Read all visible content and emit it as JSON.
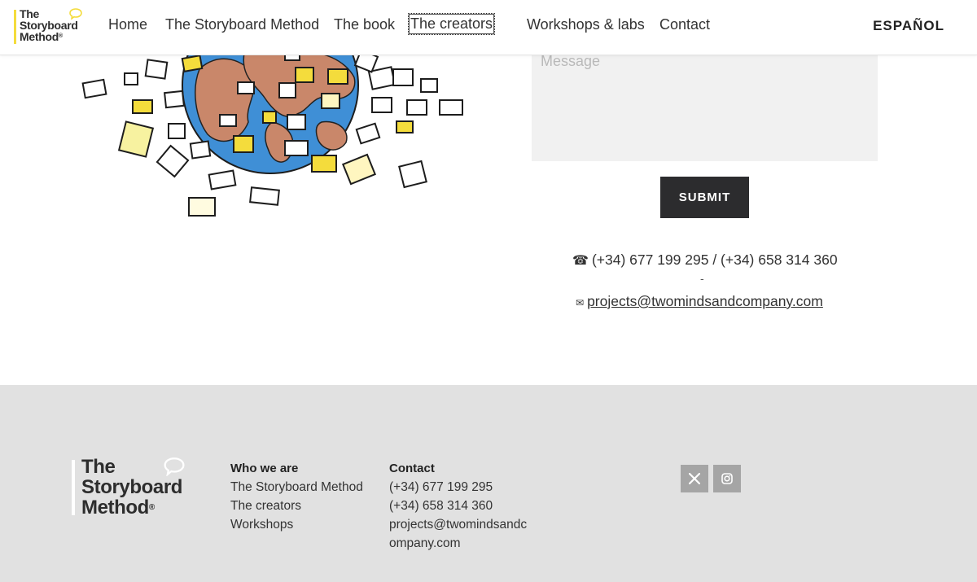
{
  "header": {
    "logo": {
      "line1": "The",
      "line2": "Storyboard",
      "line3": "Method",
      "mark": "®"
    },
    "nav": [
      {
        "label": "Home"
      },
      {
        "label": "The Storyboard Method"
      },
      {
        "label": "The book"
      },
      {
        "label": "The creators"
      },
      {
        "label": "Workshops & labs"
      },
      {
        "label": "Contact"
      }
    ],
    "language": "ESPAÑOL"
  },
  "form": {
    "message_placeholder": "Message",
    "submit_label": "SUBMIT"
  },
  "contact_info": {
    "phone_icon": "☎",
    "phones": "(+34) 677 199 295 / (+34) 658 314 360",
    "separator": "-",
    "email_icon": "✉",
    "email": "projects@twomindsandcompany.com"
  },
  "footer": {
    "logo": {
      "line1": "The",
      "line2": "Storyboard",
      "line3": "Method",
      "mark": "®"
    },
    "who": {
      "heading": "Who we are",
      "links": [
        "The Storyboard Method",
        "The creators",
        "Workshops"
      ]
    },
    "contact": {
      "heading": "Contact",
      "phone1": "(+34) 677 199 295",
      "phone2": "(+34) 658 314 360",
      "email_part1": "projects@twomindsandc",
      "email_part2": "ompany.com"
    },
    "social": [
      {
        "icon": "x-twitter-icon"
      },
      {
        "icon": "instagram-icon"
      }
    ]
  },
  "colors": {
    "accent_yellow": "#f4dc3c",
    "button_dark": "#2c2c2e",
    "footer_bg": "#e1e1e1",
    "globe_blue": "#3f8fd6",
    "land": "#c9876a"
  }
}
